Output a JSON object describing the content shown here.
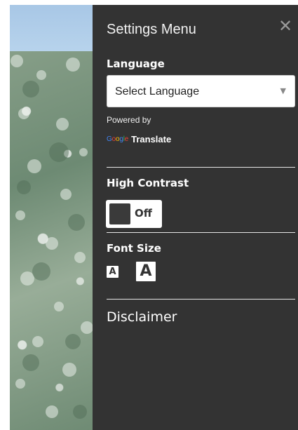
{
  "panel": {
    "title": "Settings Menu",
    "close_label": "✕"
  },
  "language": {
    "heading": "Language",
    "select_value": "Select Language",
    "powered_by": "Powered by",
    "google_letters": [
      "G",
      "o",
      "o",
      "g",
      "l",
      "e"
    ],
    "translate_label": "Translate"
  },
  "contrast": {
    "heading": "High Contrast",
    "toggle_label": "Off"
  },
  "font_size": {
    "heading": "Font Size",
    "small_label": "A",
    "large_label": "A"
  },
  "disclaimer": {
    "label": "Disclaimer"
  },
  "colors": {
    "panel_bg": "#333333",
    "google": [
      "#4285F4",
      "#EA4335",
      "#FBBC05",
      "#4285F4",
      "#34A853",
      "#EA4335"
    ]
  }
}
